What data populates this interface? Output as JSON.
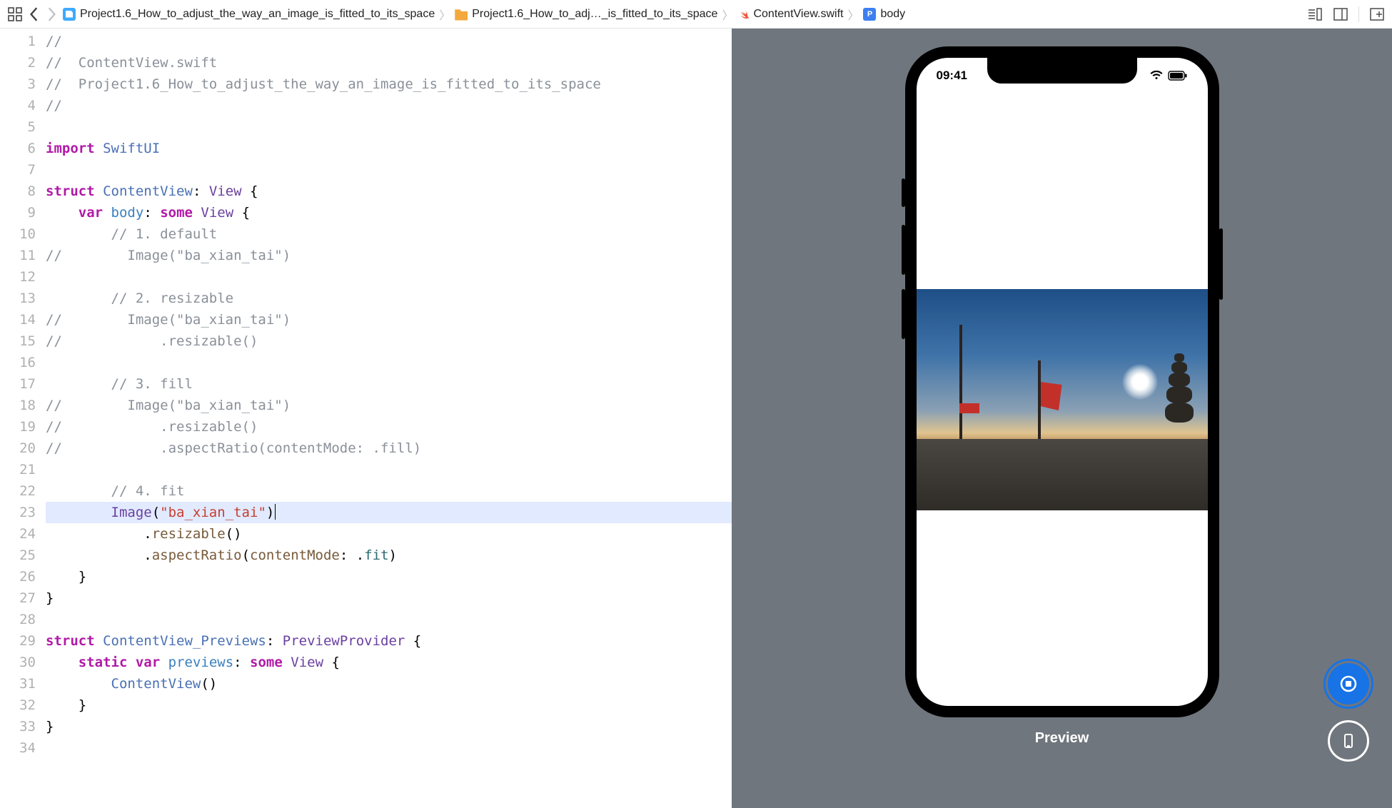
{
  "breadcrumb": {
    "item1": "Project1.6_How_to_adjust_the_way_an_image_is_fitted_to_its_space",
    "item2": "Project1.6_How_to_adj…_is_fitted_to_its_space",
    "item3": "ContentView.swift",
    "item4_prefix": "P",
    "item4": "body"
  },
  "code": {
    "lines": [
      {
        "n": 1,
        "t": "comment",
        "txt": "//"
      },
      {
        "n": 2,
        "t": "comment",
        "txt": "//  ContentView.swift"
      },
      {
        "n": 3,
        "t": "comment",
        "txt": "//  Project1.6_How_to_adjust_the_way_an_image_is_fitted_to_its_space"
      },
      {
        "n": 4,
        "t": "comment",
        "txt": "//"
      },
      {
        "n": 5,
        "t": "blank"
      },
      {
        "n": 6,
        "t": "import"
      },
      {
        "n": 7,
        "t": "blank"
      },
      {
        "n": 8,
        "t": "struct1"
      },
      {
        "n": 9,
        "t": "body"
      },
      {
        "n": 10,
        "t": "comment",
        "txt": "        // 1. default"
      },
      {
        "n": 11,
        "t": "comment",
        "txt": "//        Image(\"ba_xian_tai\")"
      },
      {
        "n": 12,
        "t": "blank"
      },
      {
        "n": 13,
        "t": "comment",
        "txt": "        // 2. resizable"
      },
      {
        "n": 14,
        "t": "comment",
        "txt": "//        Image(\"ba_xian_tai\")"
      },
      {
        "n": 15,
        "t": "comment",
        "txt": "//            .resizable()"
      },
      {
        "n": 16,
        "t": "blank"
      },
      {
        "n": 17,
        "t": "comment",
        "txt": "        // 3. fill"
      },
      {
        "n": 18,
        "t": "comment",
        "txt": "//        Image(\"ba_xian_tai\")"
      },
      {
        "n": 19,
        "t": "comment",
        "txt": "//            .resizable()"
      },
      {
        "n": 20,
        "t": "comment",
        "txt": "//            .aspectRatio(contentMode: .fill)"
      },
      {
        "n": 21,
        "t": "blank"
      },
      {
        "n": 22,
        "t": "comment",
        "txt": "        // 4. fit"
      },
      {
        "n": 23,
        "t": "image",
        "hl": true
      },
      {
        "n": 24,
        "t": "resizable"
      },
      {
        "n": 25,
        "t": "aspect"
      },
      {
        "n": 26,
        "t": "close1"
      },
      {
        "n": 27,
        "t": "close0"
      },
      {
        "n": 28,
        "t": "blank"
      },
      {
        "n": 29,
        "t": "struct2"
      },
      {
        "n": 30,
        "t": "previews"
      },
      {
        "n": 31,
        "t": "cvcall"
      },
      {
        "n": 32,
        "t": "close1"
      },
      {
        "n": 33,
        "t": "close0"
      },
      {
        "n": 34,
        "t": "blank"
      }
    ],
    "strings": {
      "import": "import",
      "swiftui": "SwiftUI",
      "struct": "struct",
      "contentview": "ContentView",
      "view": "View",
      "var": "var",
      "body_id": "body",
      "some": "some",
      "image": "Image",
      "ba_xian_tai": "\"ba_xian_tai\"",
      "resizable": "resizable",
      "aspectRatio": "aspectRatio",
      "contentMode": "contentMode",
      "fit": "fit",
      "previews_struct": "ContentView_Previews",
      "previewprovider": "PreviewProvider",
      "static": "static",
      "previews_id": "previews",
      "contentview_call": "ContentView"
    }
  },
  "preview": {
    "time": "09:41",
    "label": "Preview"
  }
}
